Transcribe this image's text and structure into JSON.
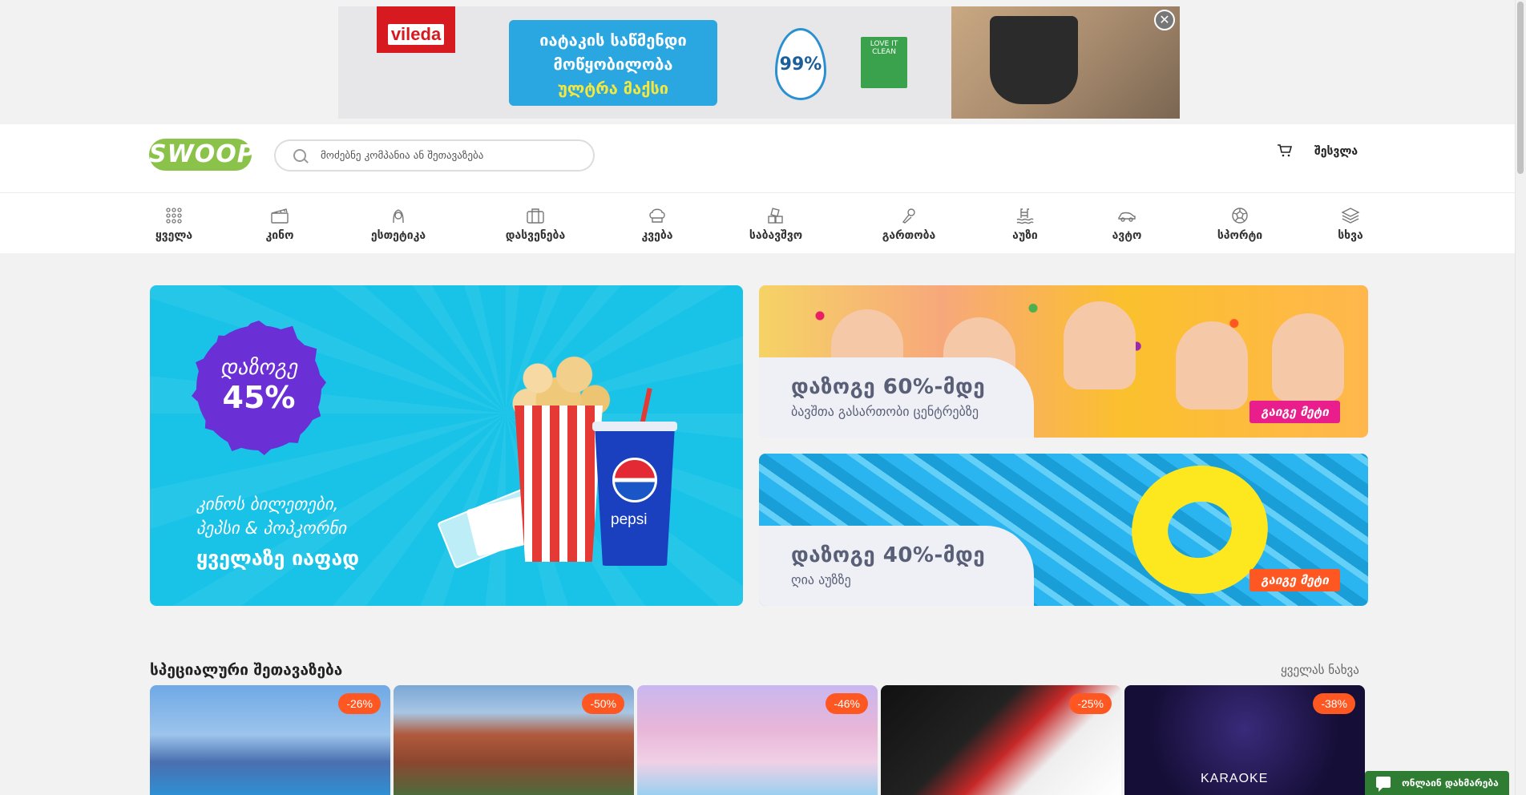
{
  "ad": {
    "brand": "vileda",
    "headline_line1": "იატაკის საწმენდი",
    "headline_line2": "მოწყობილობა",
    "headline_line3": "ულტრა მაქსი",
    "drop_value": "99%",
    "eco_label": "LOVE IT CLEAN",
    "close_label": "✕"
  },
  "header": {
    "logo": "SWOOP",
    "search_placeholder": "მოძებნე კომპანია ან შეთავაზება",
    "login": "შესვლა"
  },
  "categories": [
    {
      "label": "ყველა",
      "icon": "grid-icon"
    },
    {
      "label": "კინო",
      "icon": "clapperboard-icon"
    },
    {
      "label": "ესთეტიკა",
      "icon": "face-icon"
    },
    {
      "label": "დასვენება",
      "icon": "suitcase-icon"
    },
    {
      "label": "კვება",
      "icon": "chef-hat-icon"
    },
    {
      "label": "საბავშვო",
      "icon": "toy-blocks-icon"
    },
    {
      "label": "გართობა",
      "icon": "microphone-icon"
    },
    {
      "label": "აუზი",
      "icon": "pool-icon"
    },
    {
      "label": "ავტო",
      "icon": "car-icon"
    },
    {
      "label": "სპორტი",
      "icon": "ball-icon"
    },
    {
      "label": "სხვა",
      "icon": "layers-icon"
    }
  ],
  "hero": {
    "badge_top": "დაზოგე",
    "badge_value": "45%",
    "line1": "კინოს ბილეთები,",
    "line2": "პეპსი & პოპკორნი",
    "line3": "ყველაზე იაფად",
    "cup_brand": "pepsi"
  },
  "promos": [
    {
      "title": "დაზოგე 60%-მდე",
      "subtitle": "ბავშთა გასართობი ცენტრებზე",
      "button": "გაიგე მეტი"
    },
    {
      "title": "დაზოგე 40%-მდე",
      "subtitle": "ღია აუზზე",
      "button": "გაიგე მეტი"
    }
  ],
  "special": {
    "title": "სპეციალური შეთავაზება",
    "see_all": "ყველას ნახვა",
    "offers": [
      {
        "discount": "-26%"
      },
      {
        "discount": "-50%"
      },
      {
        "discount": "-46%"
      },
      {
        "discount": "-25%"
      },
      {
        "discount": "-38%",
        "caption": "KARAOKE"
      }
    ]
  },
  "chat": {
    "label": "ონლაინ დახმარება"
  }
}
